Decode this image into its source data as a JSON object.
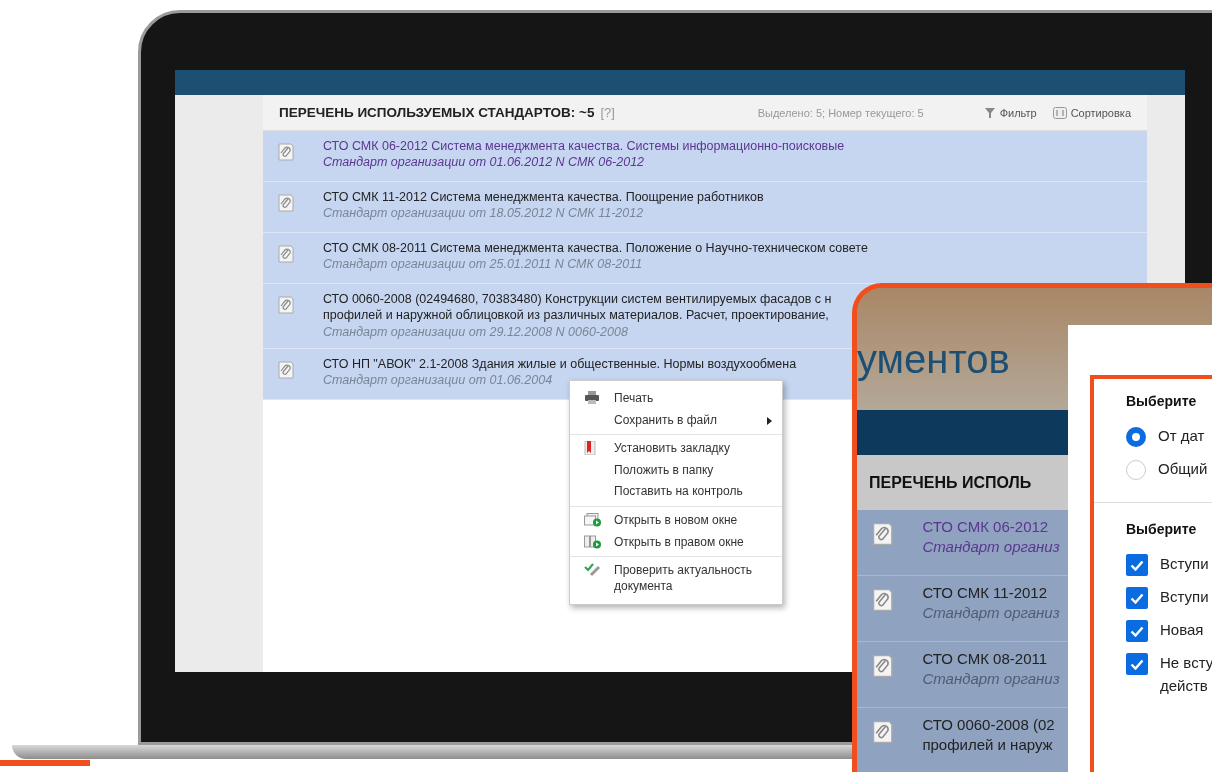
{
  "screen": {
    "panel": {
      "title": "ПЕРЕЧЕНЬ ИСПОЛЬЗУЕМЫХ СТАНДАРТОВ: ~5",
      "help": "[?]",
      "status": "Выделено: 5; Номер текущего: 5",
      "filter": "Фильтр",
      "sort": "Сортировка",
      "rows": [
        {
          "lines": [
            "СТО СМК 06-2012 Система менеджмента качества. Системы информационно-поисковые"
          ],
          "subtitle": "Стандарт организации от 01.06.2012 N СМК 06-2012",
          "visited": true
        },
        {
          "lines": [
            "СТО СМК 11-2012 Система менеджмента качества. Поощрение работников"
          ],
          "subtitle": "Стандарт организации от 18.05.2012 N СМК 11-2012",
          "visited": false
        },
        {
          "lines": [
            "СТО СМК 08-2011 Система менеджмента качества. Положение о Научно-техническом совете"
          ],
          "subtitle": "Стандарт организации от 25.01.2011 N СМК 08-2011",
          "visited": false
        },
        {
          "lines": [
            "СТО 0060-2008 (02494680, 70383480) Конструкции систем вентилируемых фасадов с н",
            "профилей и наружной облицовкой из различных материалов. Расчет, проектирование,"
          ],
          "subtitle": "Стандарт организации от 29.12.2008 N 0060-2008",
          "visited": false
        },
        {
          "lines": [
            "СТО НП \"АВОК\" 2.1-2008 Здания жилые и общественные. Нормы воздухообмена"
          ],
          "subtitle": "Стандарт организации от 01.06.2004",
          "visited": false
        }
      ]
    }
  },
  "context_menu": {
    "groups": [
      [
        {
          "label": "Печать",
          "submenu": false
        },
        {
          "label": "Сохранить в файл",
          "submenu": true
        }
      ],
      [
        {
          "label": "Установить закладку",
          "submenu": false
        },
        {
          "label": "Положить в папку",
          "submenu": false
        },
        {
          "label": "Поставить на контроль",
          "submenu": false
        }
      ],
      [
        {
          "label": "Открыть в новом окне",
          "submenu": false
        },
        {
          "label": "Открыть в правом окне",
          "submenu": false
        }
      ],
      [
        {
          "label": "Проверить актуальность документа",
          "submenu": false
        }
      ]
    ]
  },
  "overlay": {
    "heading": "ументов",
    "list_title": "ПЕРЕЧЕНЬ ИСПОЛЬ",
    "rows": [
      {
        "lines": [
          "СТО СМК 06-2012"
        ],
        "subtitle": "Стандарт организ",
        "visited": true
      },
      {
        "lines": [
          "СТО СМК 11-2012"
        ],
        "subtitle": "Стандарт организ",
        "visited": false
      },
      {
        "lines": [
          "СТО СМК 08-2011"
        ],
        "subtitle": "Стандарт организ",
        "visited": false
      },
      {
        "lines": [
          "СТО 0060-2008 (02",
          "профилей и наруж"
        ],
        "visited": false
      }
    ],
    "dialog": {
      "sections": [
        {
          "title": "Выберите",
          "kind": "radio",
          "options": [
            {
              "lines": [
                "От дат"
              ],
              "selected": true
            },
            {
              "lines": [
                "Общий"
              ],
              "selected": false
            }
          ]
        },
        {
          "title": "Выберите",
          "kind": "checkbox",
          "options": [
            {
              "lines": [
                "Вступи"
              ],
              "checked": true
            },
            {
              "lines": [
                "Вступи"
              ],
              "checked": true
            },
            {
              "lines": [
                "Новая"
              ],
              "checked": true
            },
            {
              "lines": [
                "Не всту",
                "действ"
              ],
              "checked": true
            }
          ]
        }
      ]
    }
  }
}
